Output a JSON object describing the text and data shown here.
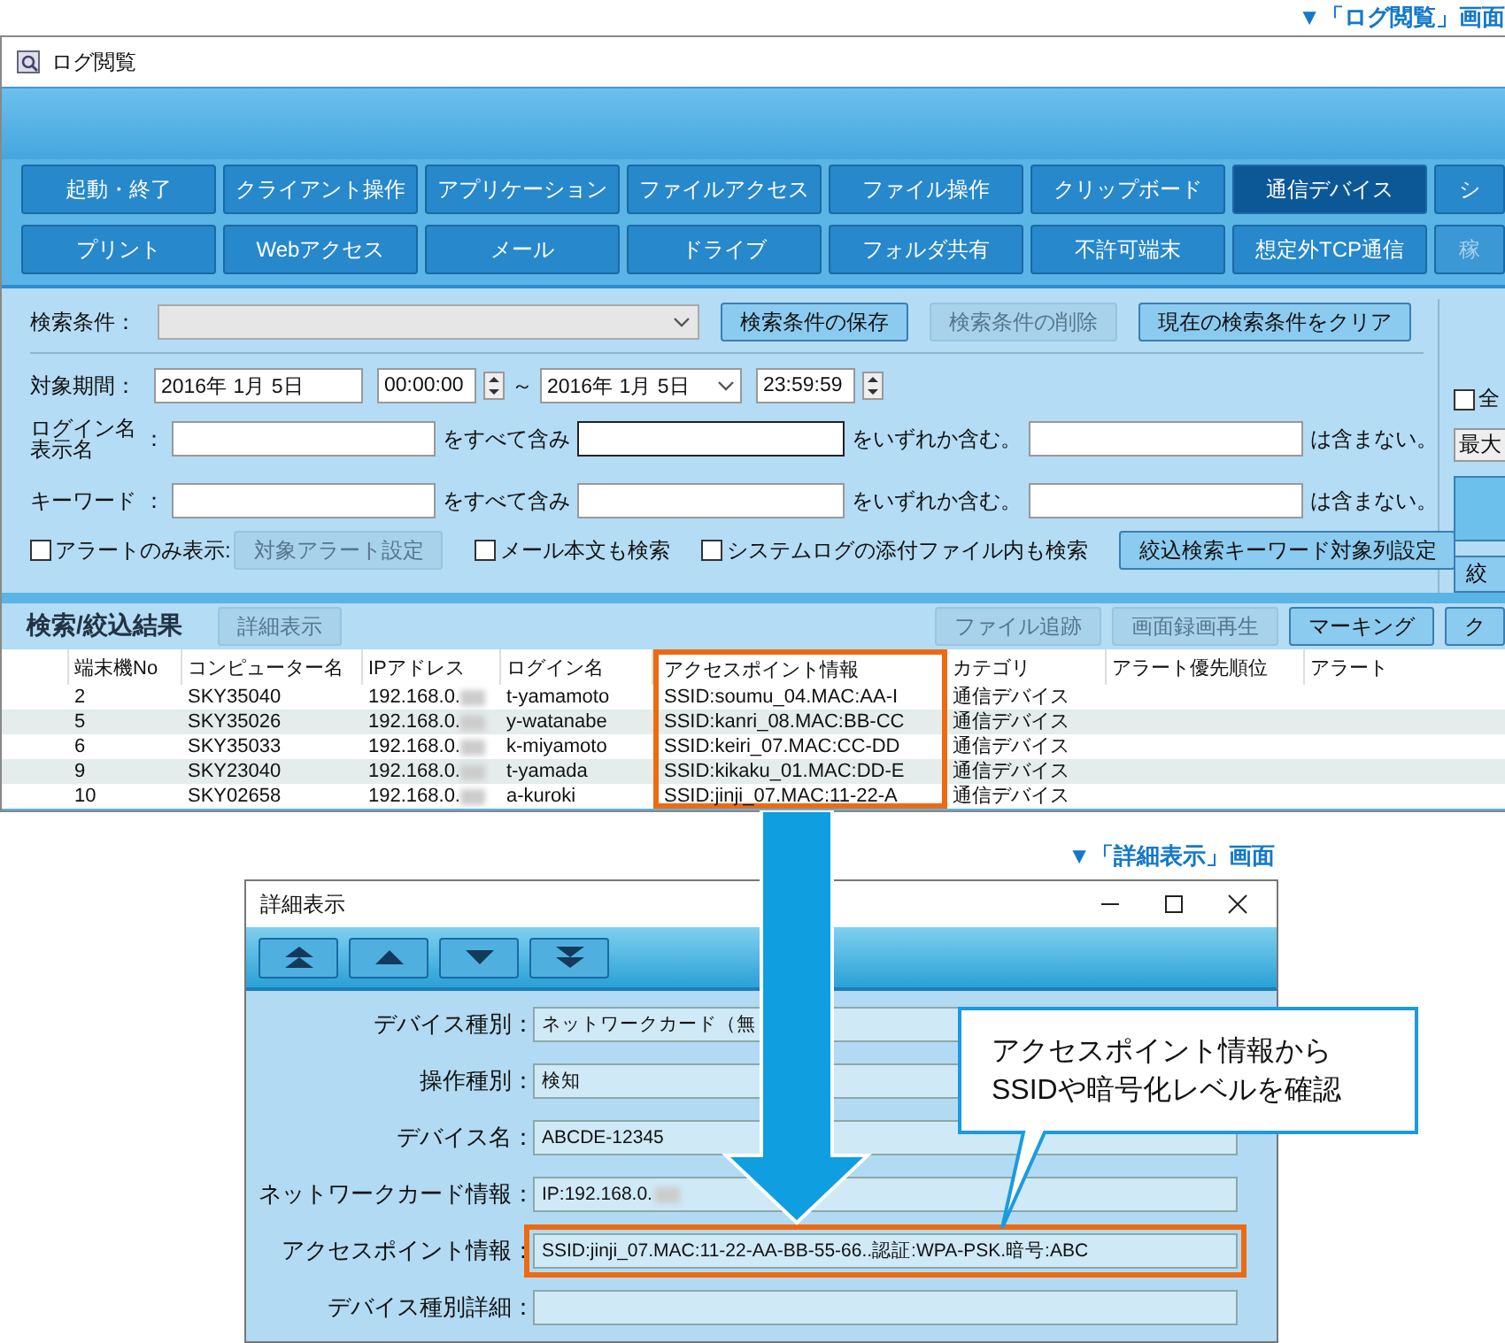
{
  "log_caption": "▼「ログ閲覧」画面",
  "log_window": {
    "title": "ログ閲覧",
    "tab_rows": [
      [
        {
          "label": "起動・終了",
          "selected": false,
          "disabled": false
        },
        {
          "label": "クライアント操作",
          "selected": false,
          "disabled": false
        },
        {
          "label": "アプリケーション",
          "selected": false,
          "disabled": false
        },
        {
          "label": "ファイルアクセス",
          "selected": false,
          "disabled": false
        },
        {
          "label": "ファイル操作",
          "selected": false,
          "disabled": false
        },
        {
          "label": "クリップボード",
          "selected": false,
          "disabled": false
        },
        {
          "label": "通信デバイス",
          "selected": true,
          "disabled": false
        },
        {
          "label": "シ",
          "selected": false,
          "disabled": false
        }
      ],
      [
        {
          "label": "プリント",
          "selected": false,
          "disabled": false
        },
        {
          "label": "Webアクセス",
          "selected": false,
          "disabled": false
        },
        {
          "label": "メール",
          "selected": false,
          "disabled": false
        },
        {
          "label": "ドライブ",
          "selected": false,
          "disabled": false
        },
        {
          "label": "フォルダ共有",
          "selected": false,
          "disabled": false
        },
        {
          "label": "不許可端末",
          "selected": false,
          "disabled": false
        },
        {
          "label": "想定外TCP通信",
          "selected": false,
          "disabled": false
        },
        {
          "label": "稼",
          "selected": false,
          "disabled": true
        }
      ]
    ],
    "search": {
      "label": "検索条件：",
      "buttons": [
        {
          "label": "検索条件の保存",
          "disabled": false
        },
        {
          "label": "検索条件の削除",
          "disabled": true
        },
        {
          "label": "現在の検索条件をクリア",
          "disabled": false
        }
      ]
    },
    "period": {
      "label": "対象期間：",
      "from_date": "2016年 1月 5日",
      "from_time": "00:00:00",
      "separator": "～",
      "to_date": "2016年 1月 5日",
      "to_time": "23:59:59"
    },
    "text_rows": [
      {
        "label_lines": [
          "ログイン名",
          "表示名"
        ],
        "colon": "：",
        "fields": [
          {
            "focused": false
          },
          {
            "focused": true
          },
          {
            "focused": false
          }
        ],
        "all_text": "をすべて含み",
        "any_text": "をいずれか含む。",
        "none_text": "は含まない。"
      },
      {
        "label_lines": [
          "キーワード"
        ],
        "colon": "：",
        "fields": [
          {
            "focused": false
          },
          {
            "focused": false
          },
          {
            "focused": false
          }
        ],
        "all_text": "をすべて含み",
        "any_text": "をいずれか含む。",
        "none_text": "は含まない。"
      }
    ],
    "options": {
      "alert_only": {
        "label": "アラートのみ表示:",
        "checked": false
      },
      "alert_button": {
        "label": "対象アラート設定",
        "disabled": true
      },
      "checkboxes": [
        {
          "label": "メール本文も検索",
          "checked": false
        },
        {
          "label": "システムログの添付ファイル内も検索",
          "checked": false
        }
      ],
      "keyword_button": {
        "label": "絞込検索キーワード対象列設定",
        "disabled": false
      }
    },
    "side_panel": {
      "checkbox": {
        "label": "全",
        "checked": false
      },
      "dropdown": "最大",
      "button": "絞"
    },
    "results": {
      "title": "検索/絞込結果",
      "left_buttons": [
        {
          "label": "詳細表示",
          "disabled": true
        }
      ],
      "right_buttons": [
        {
          "label": "ファイル追跡",
          "disabled": true
        },
        {
          "label": "画面録画再生",
          "disabled": true
        },
        {
          "label": "マーキング",
          "disabled": false
        },
        {
          "label": "ク",
          "disabled": false
        }
      ]
    },
    "table": {
      "columns": [
        {
          "label": "端末機No",
          "highlighted": false
        },
        {
          "label": "コンピューター名",
          "highlighted": false
        },
        {
          "label": "IPアドレス",
          "highlighted": false
        },
        {
          "label": "ログイン名",
          "highlighted": false
        },
        {
          "label": "アクセスポイント情報",
          "highlighted": true
        },
        {
          "label": "カテゴリ",
          "highlighted": false
        },
        {
          "label": "アラート優先順位",
          "highlighted": false
        },
        {
          "label": "アラート",
          "highlighted": false
        }
      ],
      "rows": [
        [
          "2",
          "SKY35040",
          "192.168.0.",
          "t-yamamoto",
          "SSID:soumu_04.MAC:AA-I",
          "通信デバイス",
          "",
          ""
        ],
        [
          "5",
          "SKY35026",
          "192.168.0.",
          "y-watanabe",
          "SSID:kanri_08.MAC:BB-CC",
          "通信デバイス",
          "",
          ""
        ],
        [
          "6",
          "SKY35033",
          "192.168.0.",
          "k-miyamoto",
          "SSID:keiri_07.MAC:CC-DD",
          "通信デバイス",
          "",
          ""
        ],
        [
          "9",
          "SKY23040",
          "192.168.0.",
          "t-yamada",
          "SSID:kikaku_01.MAC:DD-E",
          "通信デバイス",
          "",
          ""
        ],
        [
          "10",
          "SKY02658",
          "192.168.0.",
          "a-kuroki",
          "SSID:jinji_07.MAC:11-22-A",
          "通信デバイス",
          "",
          ""
        ]
      ]
    }
  },
  "detail_caption": "▼「詳細表示」画面",
  "detail_window": {
    "title": "詳細表示",
    "fields": [
      {
        "label": "デバイス種別",
        "colon": "：",
        "value": "ネットワークカード（無",
        "highlighted": false
      },
      {
        "label": "操作種別",
        "colon": "：",
        "value": "検知",
        "highlighted": false
      },
      {
        "label": "デバイス名",
        "colon": "：",
        "value": "ABCDE-12345",
        "highlighted": false
      },
      {
        "label": "ネットワークカード情報",
        "colon": "：",
        "value": "IP:192.168.0.",
        "highlighted": false
      },
      {
        "label": "アクセスポイント情報",
        "colon": "：",
        "value": "SSID:jinji_07.MAC:11-22-AA-BB-55-66..認証:WPA-PSK.暗号:ABC",
        "highlighted": true
      },
      {
        "label": "デバイス種別詳細",
        "colon": "：",
        "highlighted": false
      }
    ]
  },
  "callout": {
    "lines": [
      "アクセスポイント情報から",
      "SSIDや暗号化レベルを確認"
    ]
  }
}
